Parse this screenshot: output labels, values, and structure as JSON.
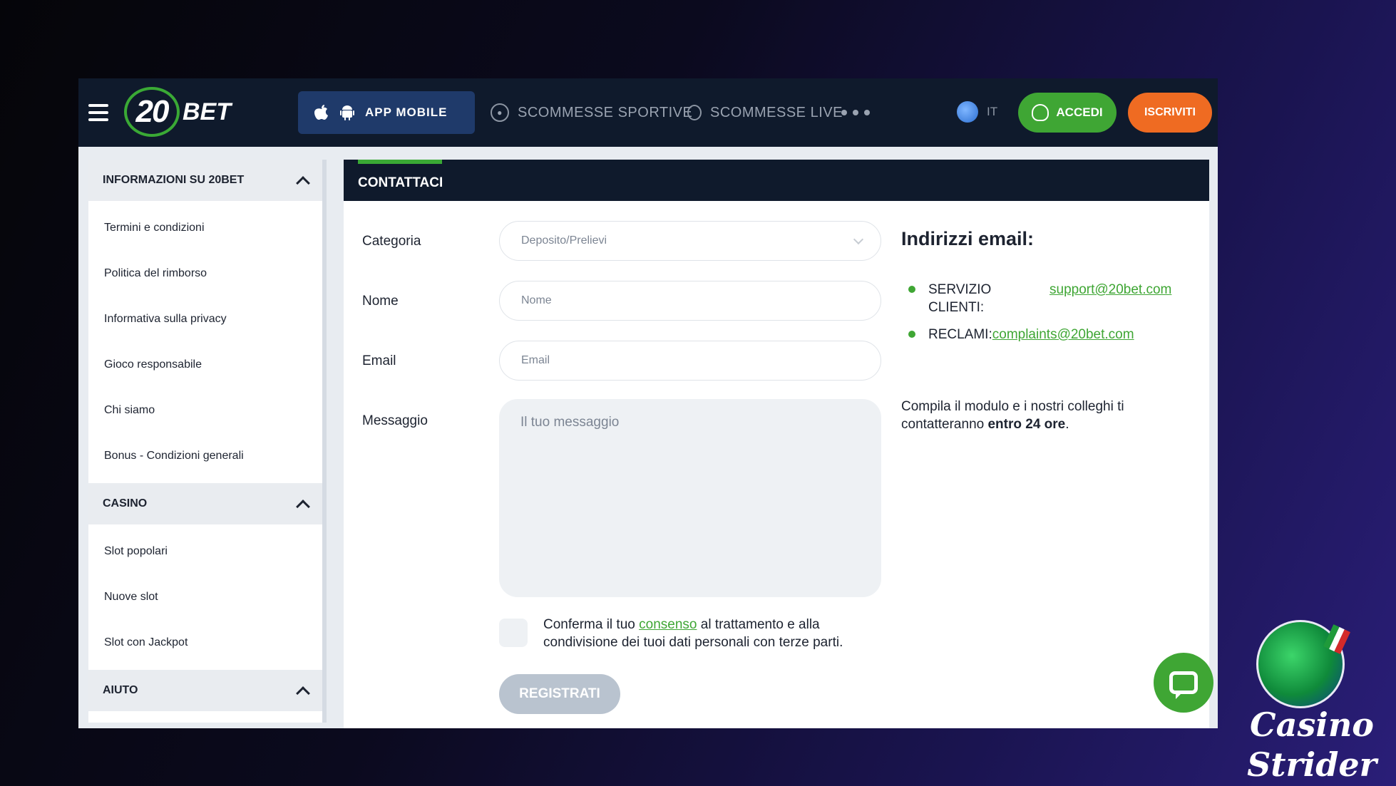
{
  "topbar": {
    "logo_number": "20",
    "logo_text": "BET",
    "app_mobile_label": "APP MOBILE",
    "nav_sport": "SCOMMESSE SPORTIVE",
    "nav_live": "SCOMMESSE LIVE",
    "lang": "IT",
    "login_label": "ACCEDI",
    "signup_label": "ISCRIVITI"
  },
  "sidebar": {
    "sections": [
      {
        "title": "INFORMAZIONI SU 20BET",
        "items": [
          "Termini e condizioni",
          "Politica del rimborso",
          "Informativa sulla privacy",
          "Gioco responsabile",
          "Chi siamo",
          "Bonus - Condizioni generali"
        ]
      },
      {
        "title": "CASINO",
        "items": [
          "Slot popolari",
          "Nuove slot",
          "Slot con Jackpot"
        ]
      },
      {
        "title": "AIUTO",
        "items": []
      }
    ]
  },
  "contact": {
    "title": "CONTATTACI",
    "category_label": "Categoria",
    "category_value": "Deposito/Prelievi",
    "name_label": "Nome",
    "name_placeholder": "Nome",
    "email_label": "Email",
    "email_placeholder": "Email",
    "message_label": "Messaggio",
    "message_placeholder": "Il tuo messaggio",
    "consent_before": "Conferma il tuo ",
    "consent_link": "consenso",
    "consent_after": " al trattamento e alla condivisione dei tuoi dati personali con terze parti.",
    "submit_label": "REGISTRATI"
  },
  "emails": {
    "title": "Indirizzi email:",
    "service_label_line1": "SERVIZIO",
    "service_label_line2": "CLIENTI:",
    "service_email": "support@20bet.com",
    "complaints_label": "RECLAMI:",
    "complaints_email": "complaints@20bet.com",
    "info_before": "Compila il modulo e i nostri colleghi ti contatteranno ",
    "info_bold": "entro 24 ore",
    "info_after": "."
  },
  "watermark": {
    "line1": "Casino",
    "line2": "Strider"
  },
  "colors": {
    "nav_bg": "#0f1a2c",
    "accent_green": "#3fa634",
    "signup_orange": "#ef6b22",
    "app_button_blue": "#1f3a6a"
  }
}
